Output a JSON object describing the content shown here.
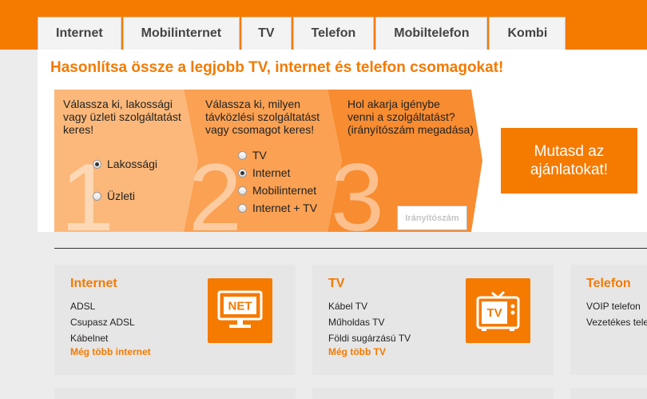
{
  "tabs": [
    "Internet",
    "Mobilinternet",
    "TV",
    "Telefon",
    "Mobiltelefon",
    "Kombi"
  ],
  "headline": "Hasonlítsa össze a legjobb TV, internet és telefon csomagokat!",
  "steps": {
    "numbers": [
      "1",
      "2",
      "3"
    ],
    "step1": {
      "lines": [
        "Válassza ki, lakossági",
        "vagy üzleti szolgáltatást",
        "keres!"
      ],
      "options": [
        {
          "label": "Lakossági",
          "checked": true
        },
        {
          "label": "Üzleti",
          "checked": false
        }
      ]
    },
    "step2": {
      "lines": [
        "Válassza ki, milyen",
        "távközlési szolgáltatást",
        "vagy csomagot keres!"
      ],
      "options": [
        {
          "label": "TV",
          "checked": false
        },
        {
          "label": "Internet",
          "checked": true
        },
        {
          "label": "Mobilinternet",
          "checked": false
        },
        {
          "label": "Internet + TV",
          "checked": false
        }
      ]
    },
    "step3": {
      "lines": [
        "Hol akarja igénybe",
        "venni a szolgáltatást?",
        "(irányítószám megadása)"
      ],
      "zip_placeholder": "Irányítószám"
    }
  },
  "cta": {
    "line1": "Mutasd az",
    "line2": "ajánlatokat!"
  },
  "cards": [
    {
      "title": "Internet",
      "items": [
        "ADSL",
        "Csupasz ADSL",
        "Kábelnet"
      ],
      "more": "Még több internet",
      "icon_text": "NET",
      "icon": "monitor-icon"
    },
    {
      "title": "TV",
      "items": [
        "Kábel TV",
        "Műholdas TV",
        "Földi sugárzású TV"
      ],
      "more": "Még több TV",
      "icon_text": "TV",
      "icon": "tv-icon"
    },
    {
      "title": "Telefon",
      "items": [
        "VOIP telefon",
        "Vezetékes telefon"
      ]
    }
  ],
  "colors": {
    "accent": "#f47a00",
    "step1": "#fbb87a",
    "step2": "#fba153",
    "step3": "#f88c31"
  }
}
